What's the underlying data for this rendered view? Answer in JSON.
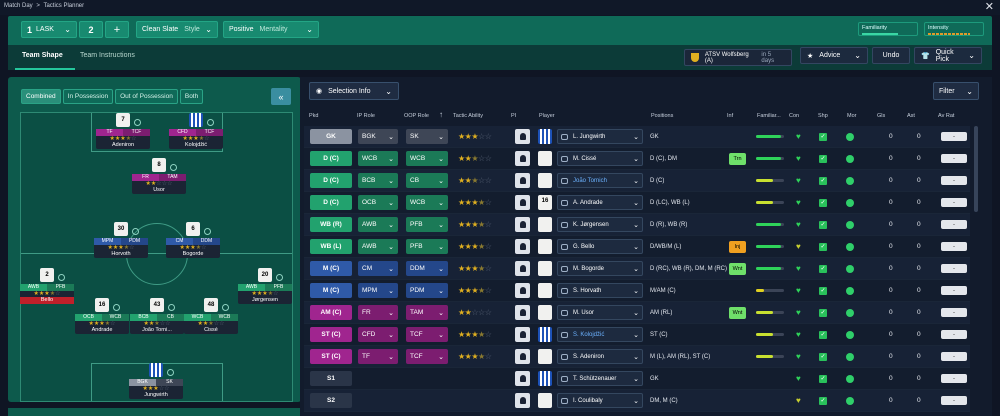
{
  "breadcrumb": {
    "item1": "Match Day",
    "sep": ">",
    "item2": "Tactics Planner"
  },
  "toolbar": {
    "tactic_num1": "1",
    "team": "LASK",
    "tactic_num2": "2",
    "add": "+",
    "style_value": "Clean Slate",
    "style_label": "Style",
    "mentality_value": "Positive",
    "mentality_label": "Mentality",
    "familiarity_label": "Familiarity",
    "intensity_label": "Intensity"
  },
  "tabs": {
    "team_shape": "Team Shape",
    "team_instructions": "Team Instructions"
  },
  "match": {
    "opponent": "ATSV Wolfsberg (A)",
    "when": "in 5 days"
  },
  "actions": {
    "advice": "Advice",
    "undo": "Undo",
    "quick_pick": "Quick Pick"
  },
  "view_tabs": [
    "Combined",
    "In Possession",
    "Out of Possession",
    "Both"
  ],
  "collapse": "«",
  "selection_info": "Selection Info",
  "filter": "Filter",
  "columns": {
    "pkd": "Pkd",
    "ip_role": "IP Role",
    "oop_role": "OOP Role",
    "tactic_ability": "Tactic Ability",
    "pi": "PI",
    "player": "Player",
    "positions": "Positions",
    "inf": "Inf",
    "familiarity": "Familiar...",
    "con": "Con",
    "shp": "Shp",
    "mor": "Mor",
    "gls": "Gls",
    "ast": "Ast",
    "av_rat": "Av Rat"
  },
  "players": [
    {
      "pos": "GK",
      "ip": "BGK",
      "oop": "SK",
      "stars": 3,
      "half": false,
      "kit": "",
      "name": "L. Jungwirth",
      "positions": "GK",
      "inf": "",
      "fam": 0.9,
      "gls": "0",
      "ast": "0",
      "avr": "-",
      "color": "gk"
    },
    {
      "pos": "D (C)",
      "ip": "WCB",
      "oop": "WCB",
      "stars": 2,
      "half": true,
      "kit": "",
      "name": "M. Cissé",
      "positions": "D (C), DM",
      "inf": "Trn",
      "fam": 0.9,
      "gls": "0",
      "ast": "0",
      "avr": "-",
      "color": "def"
    },
    {
      "pos": "D (C)",
      "ip": "BCB",
      "oop": "CB",
      "stars": 2,
      "half": true,
      "kit": "",
      "name": "João Tornich",
      "positions": "D (C)",
      "inf": "",
      "fam": 0.6,
      "gls": "0",
      "ast": "0",
      "avr": "-",
      "color": "def",
      "blue": true
    },
    {
      "pos": "D (C)",
      "ip": "OCB",
      "oop": "WCB",
      "stars": 3,
      "half": true,
      "kit": "16",
      "name": "A. Andrade",
      "positions": "D (LC), WB (L)",
      "inf": "",
      "fam": 0.6,
      "gls": "0",
      "ast": "0",
      "avr": "-",
      "color": "def"
    },
    {
      "pos": "WB (R)",
      "ip": "AWB",
      "oop": "PFB",
      "stars": 3,
      "half": true,
      "kit": "",
      "name": "K. Jørgensen",
      "positions": "D (R), WB (R)",
      "inf": "",
      "fam": 0.9,
      "gls": "0",
      "ast": "0",
      "avr": "-",
      "color": "def"
    },
    {
      "pos": "WB (L)",
      "ip": "AWB",
      "oop": "PFB",
      "stars": 3,
      "half": true,
      "kit": "",
      "name": "G. Bello",
      "positions": "D/WB/M (L)",
      "inf": "Inj",
      "fam": 0.9,
      "gls": "0",
      "ast": "0",
      "avr": "-",
      "color": "def"
    },
    {
      "pos": "M (C)",
      "ip": "CM",
      "oop": "DDM",
      "stars": 3,
      "half": true,
      "kit": "",
      "name": "M. Bogorde",
      "positions": "D (RC), WB (R), DM, M (RC)",
      "inf": "Wnt",
      "fam": 0.9,
      "gls": "0",
      "ast": "0",
      "avr": "-",
      "color": "mid"
    },
    {
      "pos": "M (C)",
      "ip": "MPM",
      "oop": "PDM",
      "stars": 3,
      "half": true,
      "kit": "",
      "name": "S. Horvath",
      "positions": "M/AM (C)",
      "inf": "",
      "fam": 0.3,
      "gls": "0",
      "ast": "0",
      "avr": "-",
      "color": "mid"
    },
    {
      "pos": "AM (C)",
      "ip": "FR",
      "oop": "TAM",
      "stars": 2,
      "half": false,
      "kit": "",
      "name": "M. Usor",
      "positions": "AM (RL)",
      "inf": "Wnt",
      "fam": 0.6,
      "gls": "0",
      "ast": "0",
      "avr": "-",
      "color": "att"
    },
    {
      "pos": "ST (C)",
      "ip": "CFD",
      "oop": "TCF",
      "stars": 3,
      "half": true,
      "kit": "",
      "name": "S. Kolojdžić",
      "positions": "ST (C)",
      "inf": "",
      "fam": 0.6,
      "gls": "0",
      "ast": "0",
      "avr": "-",
      "color": "att",
      "blue": true
    },
    {
      "pos": "ST (C)",
      "ip": "TF",
      "oop": "TCF",
      "stars": 3,
      "half": true,
      "kit": "",
      "name": "S. Adeniron",
      "positions": "M (L), AM (RL), ST (C)",
      "inf": "",
      "fam": 0.6,
      "gls": "0",
      "ast": "0",
      "avr": "-",
      "color": "att"
    },
    {
      "pos": "S1",
      "ip": "",
      "oop": "",
      "stars": 0,
      "half": false,
      "kit": "",
      "name": "T. Schützenauer",
      "positions": "GK",
      "inf": "",
      "fam": 0,
      "gls": "0",
      "ast": "0",
      "avr": "-",
      "color": "sub"
    },
    {
      "pos": "S2",
      "ip": "",
      "oop": "",
      "stars": 0,
      "half": false,
      "kit": "",
      "name": "I. Coulibaly",
      "positions": "DM, M (C)",
      "inf": "",
      "fam": 0,
      "gls": "0",
      "ast": "0",
      "avr": "-",
      "color": "sub"
    }
  ],
  "pitch": [
    {
      "num": "7",
      "r1": "TF",
      "r2": "TCF",
      "stars": 3,
      "half": true,
      "name": "Adeniron",
      "c": "att"
    },
    {
      "num": "",
      "r1": "CFD",
      "r2": "TCF",
      "stars": 3,
      "half": true,
      "name": "Kolojdžić",
      "c": "att"
    },
    {
      "num": "8",
      "r1": "FR",
      "r2": "TAM",
      "stars": 2,
      "half": false,
      "name": "Usor",
      "c": "att"
    },
    {
      "num": "30",
      "r1": "MPM",
      "r2": "PDM",
      "stars": 3,
      "half": true,
      "name": "Horvoth",
      "c": "mid"
    },
    {
      "num": "6",
      "r1": "CM",
      "r2": "DDM",
      "stars": 3,
      "half": true,
      "name": "Bogorde",
      "c": "mid"
    },
    {
      "num": "2",
      "r1": "AWB",
      "r2": "PFB",
      "stars": 3,
      "half": true,
      "name": "Bello",
      "c": "def"
    },
    {
      "num": "20",
      "r1": "AWB",
      "r2": "PFB",
      "stars": 3,
      "half": true,
      "name": "Jørgensen",
      "c": "def"
    },
    {
      "num": "16",
      "r1": "OCB",
      "r2": "WCB",
      "stars": 3,
      "half": true,
      "name": "Andrade",
      "c": "def"
    },
    {
      "num": "43",
      "r1": "BCB",
      "r2": "CB",
      "stars": 2,
      "half": true,
      "name": "João Torni...",
      "c": "def"
    },
    {
      "num": "48",
      "r1": "WCB",
      "r2": "WCB",
      "stars": 2,
      "half": true,
      "name": "Cissé",
      "c": "def"
    },
    {
      "num": "",
      "r1": "BGK",
      "r2": "SK",
      "stars": 3,
      "half": false,
      "name": "Jungwirth",
      "c": "gk"
    }
  ],
  "colors": {
    "gk": "#8b93a1",
    "def": "#22a26e",
    "mid": "#2f5aa8",
    "att": "#a0258f",
    "sub": "#2a3548",
    "accent": "#25c79c",
    "team_teal": "#0f6a58"
  }
}
